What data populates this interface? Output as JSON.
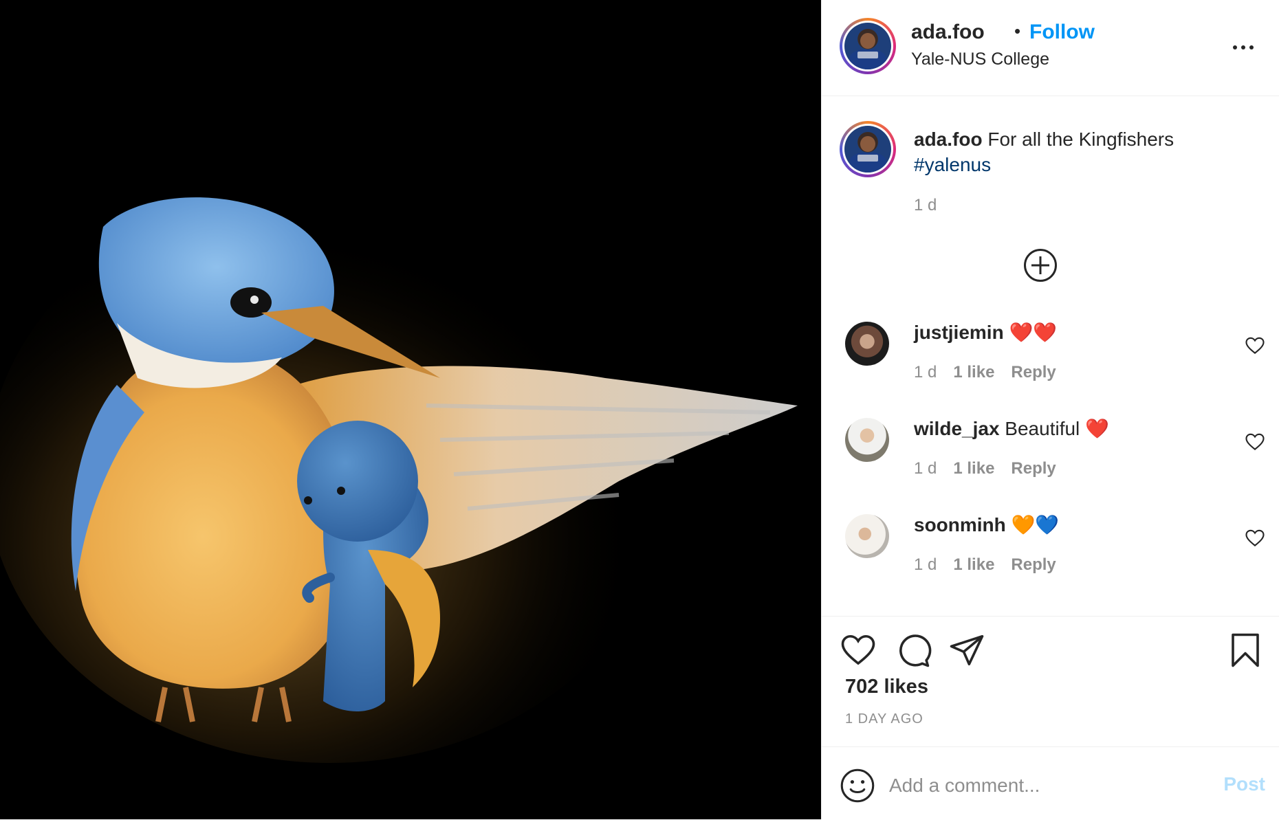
{
  "post": {
    "username": "ada.foo",
    "follow_label": "Follow",
    "separator": "•",
    "location": "Yale-NUS College",
    "caption_user": "ada.foo",
    "caption_text": "For all the Kingfishers",
    "hashtag": "#yalenus",
    "caption_time": "1 d",
    "likes": "702 likes",
    "time_ago": "1 DAY AGO"
  },
  "comments": [
    {
      "username": "justjiemin",
      "text": "❤️❤️",
      "time": "1 d",
      "likes": "1 like",
      "reply": "Reply"
    },
    {
      "username": "wilde_jax",
      "text": "Beautiful ❤️",
      "time": "1 d",
      "likes": "1 like",
      "reply": "Reply"
    },
    {
      "username": "soonminh",
      "text": "🧡💙",
      "time": "1 d",
      "likes": "1 like",
      "reply": "Reply"
    }
  ],
  "add_comment": {
    "placeholder": "Add a comment...",
    "post_label": "Post"
  },
  "colors": {
    "link_blue": "#0095f6",
    "hashtag": "#00376b",
    "post_disabled": "#b2dffc",
    "media_bg": "#000000"
  },
  "icons": [
    "more-icon",
    "load-more-icon",
    "heart-icon",
    "comment-icon",
    "share-icon",
    "bookmark-icon",
    "emoji-icon"
  ]
}
